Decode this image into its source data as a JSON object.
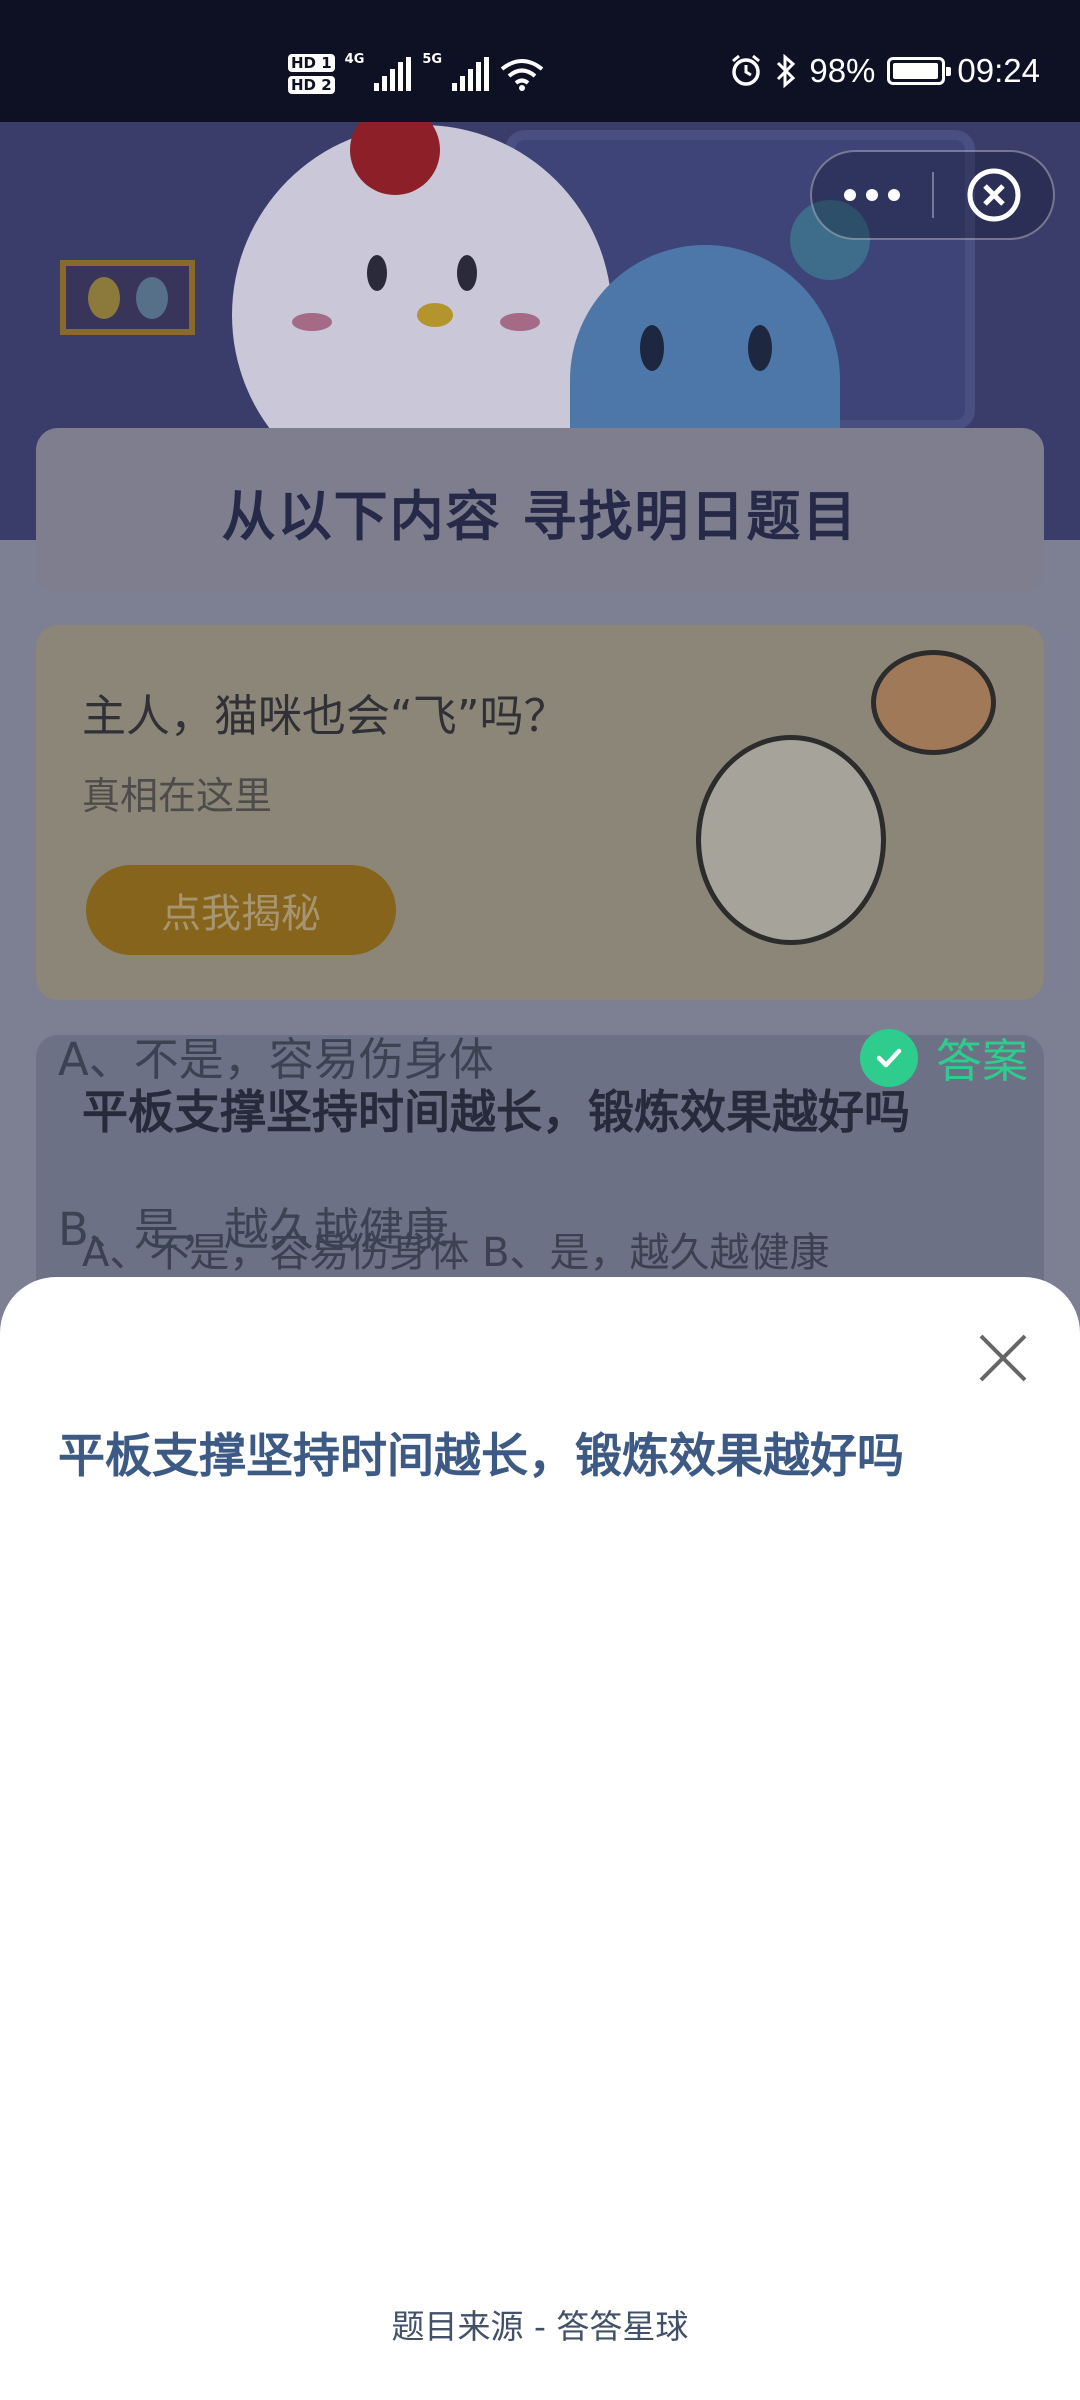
{
  "status_bar": {
    "hd1": "HD 1",
    "hd2": "HD 2",
    "net1": "4G",
    "net2": "5G",
    "battery_percent_text": "98%",
    "battery_level": 0.98,
    "time": "09:24"
  },
  "capsule": {
    "more_icon": "more-dots-icon",
    "close_icon": "close-circle-icon"
  },
  "banner": {
    "title": "从以下内容  寻找明日题目"
  },
  "promo": {
    "title": "主人，猫咪也会“飞”吗？",
    "subtitle": "真相在这里",
    "button": "点我揭秘"
  },
  "quiz_card": {
    "question": "平板支撑坚持时间越长，锻炼效果越好吗",
    "options_line": "A、不是，容易伤身体    B、是，越久越健康"
  },
  "sheet": {
    "question": "平板支撑坚持时间越长，锻炼效果越好吗",
    "option_a": "A、不是，容易伤身体",
    "option_b": "B、是，越久越健康",
    "answer_label": "答案",
    "source": "题目来源 - 答答星球",
    "colors": {
      "accent": "#2ecc8d",
      "question": "#3c5a84"
    }
  }
}
